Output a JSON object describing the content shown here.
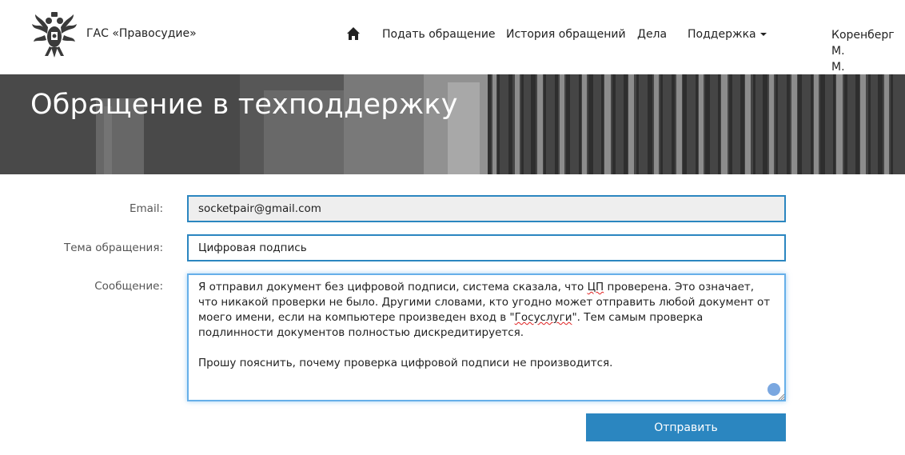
{
  "header": {
    "brand": "ГАС «Правосудие»",
    "nav": [
      {
        "label": "Подать обращение"
      },
      {
        "label": "История обращений"
      },
      {
        "label": "Дела"
      },
      {
        "label": "Поддержка"
      }
    ],
    "user_line1": "Коренберг М.",
    "user_line2": "М."
  },
  "hero": {
    "title": "Обращение в техподдержку"
  },
  "form": {
    "email_label": "Email:",
    "email_value": "socketpair@gmail.com",
    "subject_label": "Тема обращения:",
    "subject_value": "Цифровая подпись",
    "message_label": "Сообщение:",
    "message": {
      "p1_a": "Я отправил документ без цифровой подписи, система сказала, что ",
      "p1_cp": "ЦП",
      "p1_b": " проверена. Это означает, что никакой проверки не было. Другими словами, кто угодно может отправить любой документ от моего имени, если на компьютере произведен вход в \"",
      "p1_gos": "Госуслуги",
      "p1_c": "\". Тем самым проверка подлинности документов полностью дискредитируется.",
      "p2": "Прошу пояснить, почему проверка цифровой подписи не производится."
    },
    "submit_label": "Отправить"
  },
  "colors": {
    "accent": "#2b86c0",
    "focus": "#66afe9"
  }
}
